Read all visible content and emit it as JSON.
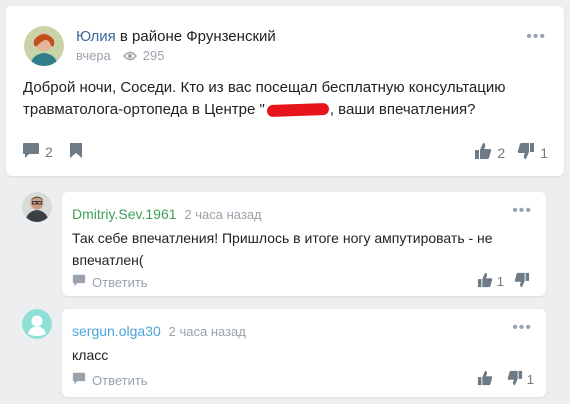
{
  "colors": {
    "background": "#edeef0",
    "link_blue": "#3f6a9b",
    "comment_author_green": "#3f9f59",
    "comment_author_blue": "#4aa6d6",
    "muted": "#9aa3ad",
    "redaction": "#e8141c"
  },
  "post": {
    "author": "Юлия",
    "location": "в районе Фрунзенский",
    "time": "вчера",
    "views": "295",
    "text_before": "Доброй ночи, Соседи. Кто из вас посещал бесплатную консультацию травматолога-ортопеда в Центре \"",
    "text_after": ", ваши впечатления?",
    "comments_count": "2",
    "likes": "2",
    "dislikes": "1",
    "icons": [
      "more-dots-icon",
      "eye-icon",
      "comment-icon",
      "bookmark-icon",
      "thumbs-up-icon",
      "thumbs-down-icon"
    ]
  },
  "comments": [
    {
      "author": "Dmitriy.Sev.1961",
      "time": "2 часа назад",
      "text": "Так себе впечатления! Пришлось в итоге ногу ампутировать - не впечатлен(",
      "reply_label": "Ответить",
      "likes": "1",
      "dislikes": ""
    },
    {
      "author": "sergun.olga30",
      "time": "2 часа назад",
      "text": "класс",
      "reply_label": "Ответить",
      "likes": "",
      "dislikes": "1"
    }
  ]
}
